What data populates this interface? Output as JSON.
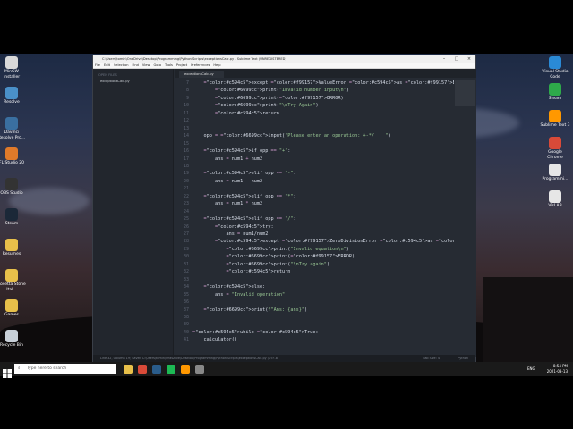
{
  "window": {
    "title": "C:\\Users\\tomin\\OneDrive\\Desktop\\Programming\\Python Scripts\\exceptionsCalc.py - Sublime Text (UNREGISTERED)",
    "menu": [
      "File",
      "Edit",
      "Selection",
      "Find",
      "View",
      "Goto",
      "Tools",
      "Project",
      "Preferences",
      "Help"
    ],
    "sidebar": {
      "header": "OPEN FILES",
      "file": "exceptionsCalc.py"
    },
    "tab": "exceptionsCalc.py",
    "status": {
      "left": "Line 32, Column 19; Saved C:\\Users\\tomin\\OneDrive\\Desktop\\Programming\\Python Scripts\\exceptionsCalc.py (UTF-8)",
      "tab_size": "Tab Size: 4",
      "syntax": "Python"
    },
    "code_lines": [
      {
        "n": "7",
        "t": "    except ValueError as ERROR:"
      },
      {
        "n": "8",
        "t": "        print(\"Invalid number input\\n\")"
      },
      {
        "n": "9",
        "t": "        print(ERROR)"
      },
      {
        "n": "10",
        "t": "        print(\"\\nTry Again\")"
      },
      {
        "n": "11",
        "t": "        return"
      },
      {
        "n": "12",
        "t": ""
      },
      {
        "n": "13",
        "t": ""
      },
      {
        "n": "14",
        "t": "    opp = input(\"Please enter an operation: +-*/    \")"
      },
      {
        "n": "15",
        "t": ""
      },
      {
        "n": "16",
        "t": "    if opp == \"+\":"
      },
      {
        "n": "17",
        "t": "        ans = num1 + num2"
      },
      {
        "n": "18",
        "t": ""
      },
      {
        "n": "19",
        "t": "    elif opp == \"-\":"
      },
      {
        "n": "20",
        "t": "        ans = num1 - num2"
      },
      {
        "n": "21",
        "t": ""
      },
      {
        "n": "22",
        "t": "    elif opp == \"*\":"
      },
      {
        "n": "23",
        "t": "        ans = num1 * num2"
      },
      {
        "n": "24",
        "t": ""
      },
      {
        "n": "25",
        "t": "    elif opp == \"/\":"
      },
      {
        "n": "26",
        "t": "        try:"
      },
      {
        "n": "27",
        "t": "            ans = num1/num2"
      },
      {
        "n": "28",
        "t": "        except ZeroDivisionError as ERROR:"
      },
      {
        "n": "29",
        "t": "            print(\"Invalid equation\\n\")"
      },
      {
        "n": "30",
        "t": "            print(ERROR)"
      },
      {
        "n": "31",
        "t": "            print(\"\\nTry again\")"
      },
      {
        "n": "32",
        "t": "            return"
      },
      {
        "n": "33",
        "t": ""
      },
      {
        "n": "34",
        "t": "    else:"
      },
      {
        "n": "35",
        "t": "        ans = \"Invalid operation\""
      },
      {
        "n": "36",
        "t": ""
      },
      {
        "n": "37",
        "t": "    print(f\"Ans: {ans}\")"
      },
      {
        "n": "38",
        "t": ""
      },
      {
        "n": "39",
        "t": ""
      },
      {
        "n": "40",
        "t": "while True:"
      },
      {
        "n": "41",
        "t": "    calculator()"
      }
    ]
  },
  "desktop_left": [
    {
      "label": "MinGW Installer",
      "icon": "mingw-icon",
      "color": "#d9d9d9"
    },
    {
      "label": "Resolve",
      "icon": "resolve-icon",
      "color": "#4a90c8"
    },
    {
      "label": "Davinci Resolve Pro...",
      "icon": "resolve-pro-icon",
      "color": "#3a6fa0"
    },
    {
      "label": "FL Studio 20",
      "icon": "flstudio-icon",
      "color": "#e07a2a"
    },
    {
      "label": "OBS Studio",
      "icon": "obs-icon",
      "color": "#333"
    },
    {
      "label": "Steam",
      "icon": "steam-icon",
      "color": "#1b2838"
    },
    {
      "label": "Resumes",
      "icon": "folder-icon",
      "color": "#e8c04a"
    },
    {
      "label": "Rosetta Stone Ital...",
      "icon": "folder-icon",
      "color": "#e8c04a"
    },
    {
      "label": "Games",
      "icon": "folder-icon",
      "color": "#e8c04a"
    },
    {
      "label": "Recycle Bin",
      "icon": "recycle-bin-icon",
      "color": "#c8d0d8"
    }
  ],
  "desktop_right": [
    {
      "label": "Visual Studio Code",
      "icon": "vscode-icon",
      "color": "#2a8ad6"
    },
    {
      "label": "Steam",
      "icon": "steam-icon",
      "color": "#2eaa4a"
    },
    {
      "label": "Sublime Text 3",
      "icon": "sublime-icon",
      "color": "#ff9800"
    },
    {
      "label": "Google Chrome",
      "icon": "chrome-icon",
      "color": "#d94a38"
    },
    {
      "label": "Programmi...",
      "icon": "file-icon",
      "color": "#e6e6e6"
    },
    {
      "label": "VisLAB",
      "icon": "file-icon",
      "color": "#e6e6e6"
    }
  ],
  "taskbar": {
    "search_placeholder": "Type here to search",
    "apps": [
      {
        "icon": "file-explorer-icon",
        "color": "#e8c04a"
      },
      {
        "icon": "chrome-icon",
        "color": "#d94a38"
      },
      {
        "icon": "steam-icon",
        "color": "#2a5c8a"
      },
      {
        "icon": "spotify-icon",
        "color": "#1db954"
      },
      {
        "icon": "sublime-icon",
        "color": "#ff9800"
      },
      {
        "icon": "settings-icon",
        "color": "#888"
      }
    ],
    "lang": "ENG",
    "time": "8:54 PM",
    "date": "2021-03-13"
  },
  "colors": {
    "keyword": "#c594c5",
    "string": "#99c794",
    "builtin": "#6699cc",
    "error": "#f99157",
    "default": "#d8dee9"
  }
}
